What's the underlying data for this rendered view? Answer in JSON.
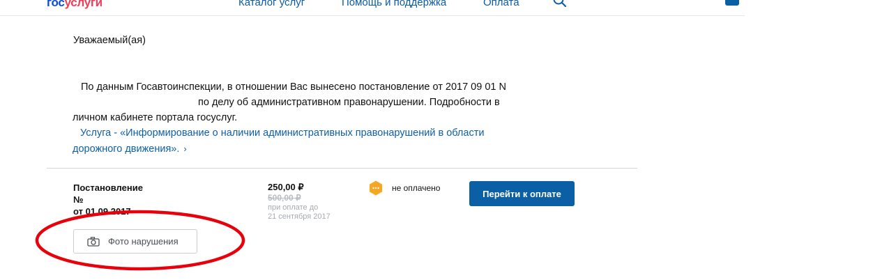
{
  "header": {
    "logo_part1": "гос",
    "logo_part2": "услуги",
    "nav": [
      "Каталог услуг",
      "Помощь и поддержка",
      "Оплата"
    ],
    "search_icon": "search-icon",
    "profile_icon": "user-icon"
  },
  "notice": {
    "greeting": "Уважаемый(ая)",
    "line1": "По данным Госавтоинспекции, в отношении Вас вынесено постановление от 2017 09 01 N",
    "line2": "по делу об административном правонарушении. Подробности в",
    "line3": "личном кабинете портала госуслуг.",
    "service_link_line1": "Услуга - «Информирование о наличии административных правонарушений в области",
    "service_link_line2": "дорожного движения».",
    "chevron": "›"
  },
  "fine": {
    "title_line1": "Постановление",
    "title_line2": "№",
    "title_line3": "от 01.09.2017",
    "amount": "250,00 ₽",
    "old_amount": "500,00 ₽",
    "pay_note_line1": "при оплате до",
    "pay_note_line2": "21 сентября 2017",
    "status": "не оплачено",
    "status_color": "#f5a623",
    "pay_button": "Перейти к оплате",
    "photo_button": "Фото нарушения",
    "annotation_color": "#e8000b"
  }
}
